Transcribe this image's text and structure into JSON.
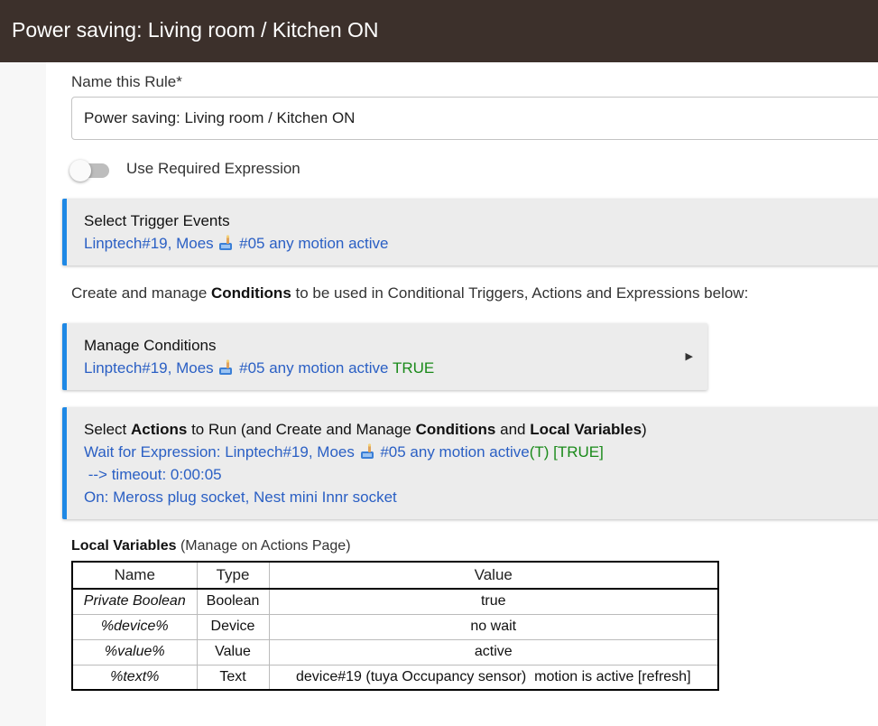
{
  "header": {
    "title": "Power saving: Living room / Kitchen ON"
  },
  "form": {
    "name_label": "Name this Rule*",
    "name_value": "Power saving: Living room / Kitchen ON",
    "toggle_label": "Use Required Expression",
    "toggle_on": false
  },
  "trigger_panel": {
    "title": "Select Trigger Events",
    "line_pre": "Linptech#19, Moes",
    "line_post": "#05 any motion active"
  },
  "conditions_hint": {
    "pre": "Create and manage",
    "bold": "Conditions",
    "post": "to be used in Conditional Triggers, Actions and Expressions below:"
  },
  "conditions_panel": {
    "title": "Manage Conditions",
    "line_pre": "Linptech#19, Moes",
    "line_post": "#05 any motion active",
    "status": "TRUE"
  },
  "actions_panel": {
    "title_pre": "Select",
    "title_b1": "Actions",
    "title_mid1": "to Run (and Create and Manage",
    "title_b2": "Conditions",
    "title_mid2": "and",
    "title_b3": "Local Variables",
    "title_post": ")",
    "line1_pre": "Wait for Expression: Linptech#19, Moes",
    "line1_post": "#05 any motion active",
    "line1_green": "(T) [TRUE]",
    "line2": " --> timeout: 0:00:05",
    "line3": "On: Meross plug socket, Nest mini Innr socket"
  },
  "local_variables": {
    "title": "Local Variables",
    "subtitle": "(Manage on Actions Page)",
    "headers": [
      "Name",
      "Type",
      "Value"
    ],
    "rows": [
      {
        "name": "Private Boolean",
        "type": "Boolean",
        "value": "true"
      },
      {
        "name": "%device%",
        "type": "Device",
        "value": "no wait"
      },
      {
        "name": "%value%",
        "type": "Value",
        "value": "active"
      },
      {
        "name": "%text%",
        "type": "Text",
        "value": "device#19 (tuya Occupancy sensor)  motion is active [refresh]"
      }
    ]
  },
  "icons": {
    "device": "device-emoji-icon",
    "expand": "triangle-right-icon"
  },
  "colors": {
    "header_bg": "#3c302b",
    "accent": "#1e88e5",
    "link": "#2a5fc4",
    "true": "#1a8a1a"
  }
}
